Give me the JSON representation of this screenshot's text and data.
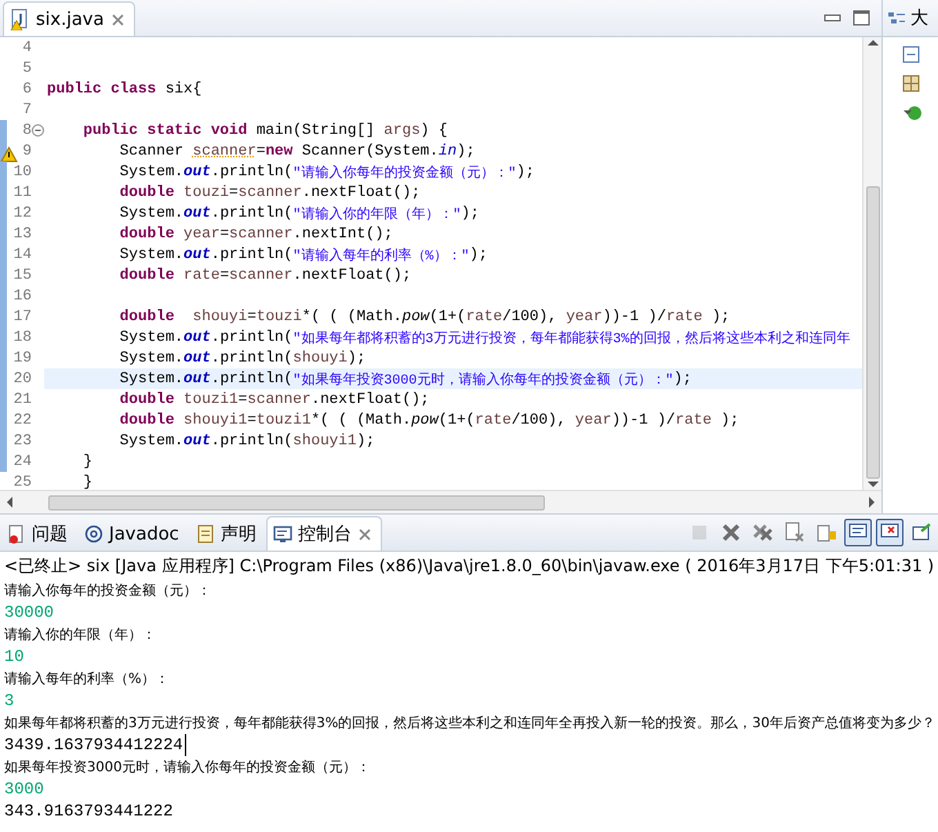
{
  "editor": {
    "tab": {
      "title": "six.java",
      "selected": true,
      "warning": true
    },
    "lines": [
      {
        "number": "4",
        "changed": false,
        "current": false,
        "warning": false,
        "foldable": false
      },
      {
        "number": "5",
        "changed": false,
        "current": false,
        "warning": false,
        "foldable": false
      },
      {
        "number": "6",
        "changed": false,
        "current": false,
        "warning": false,
        "foldable": false,
        "tokens": [
          {
            "kind": "kw",
            "text": "public class"
          },
          {
            "kind": "plain",
            "text": " six{"
          }
        ]
      },
      {
        "number": "7",
        "changed": false,
        "current": false,
        "warning": false,
        "foldable": false
      },
      {
        "number": "8",
        "changed": true,
        "current": false,
        "warning": false,
        "foldable": true,
        "tokens": [
          {
            "kind": "kw",
            "text": "    public static void"
          },
          {
            "kind": "plain",
            "text": " main(String[] "
          },
          {
            "kind": "var",
            "text": "args"
          },
          {
            "kind": "plain",
            "text": ") {"
          }
        ]
      },
      {
        "number": "9",
        "changed": true,
        "current": false,
        "warning": true,
        "foldable": false,
        "tokens": [
          {
            "kind": "plain",
            "text": "        Scanner "
          },
          {
            "kind": "warnvar",
            "text": "scanner"
          },
          {
            "kind": "plain",
            "text": "="
          },
          {
            "kind": "kw",
            "text": "new"
          },
          {
            "kind": "plain",
            "text": " Scanner(System."
          },
          {
            "kind": "static",
            "text": "in"
          },
          {
            "kind": "plain",
            "text": ");"
          }
        ]
      },
      {
        "number": "10",
        "changed": true,
        "current": false,
        "warning": false,
        "foldable": false,
        "tokens": [
          {
            "kind": "plain",
            "text": "        System."
          },
          {
            "kind": "field",
            "text": "out"
          },
          {
            "kind": "plain",
            "text": ".println("
          },
          {
            "kind": "str",
            "text": "\"请输入你每年的投资金额（元）：\""
          },
          {
            "kind": "plain",
            "text": ");"
          }
        ]
      },
      {
        "number": "11",
        "changed": true,
        "current": false,
        "warning": false,
        "foldable": false,
        "tokens": [
          {
            "kind": "kw",
            "text": "        double"
          },
          {
            "kind": "var",
            "text": " touzi"
          },
          {
            "kind": "plain",
            "text": "="
          },
          {
            "kind": "var",
            "text": "scanner"
          },
          {
            "kind": "plain",
            "text": ".nextFloat();"
          }
        ]
      },
      {
        "number": "12",
        "changed": true,
        "current": false,
        "warning": false,
        "foldable": false,
        "tokens": [
          {
            "kind": "plain",
            "text": "        System."
          },
          {
            "kind": "field",
            "text": "out"
          },
          {
            "kind": "plain",
            "text": ".println("
          },
          {
            "kind": "str",
            "text": "\"请输入你的年限（年）：\""
          },
          {
            "kind": "plain",
            "text": ");"
          }
        ]
      },
      {
        "number": "13",
        "changed": true,
        "current": false,
        "warning": false,
        "foldable": false,
        "tokens": [
          {
            "kind": "kw",
            "text": "        double"
          },
          {
            "kind": "var",
            "text": " year"
          },
          {
            "kind": "plain",
            "text": "="
          },
          {
            "kind": "var",
            "text": "scanner"
          },
          {
            "kind": "plain",
            "text": ".nextInt();"
          }
        ]
      },
      {
        "number": "14",
        "changed": true,
        "current": false,
        "warning": false,
        "foldable": false,
        "tokens": [
          {
            "kind": "plain",
            "text": "        System."
          },
          {
            "kind": "field",
            "text": "out"
          },
          {
            "kind": "plain",
            "text": ".println("
          },
          {
            "kind": "str",
            "text": "\"请输入每年的利率（%）：\""
          },
          {
            "kind": "plain",
            "text": ");"
          }
        ]
      },
      {
        "number": "15",
        "changed": true,
        "current": false,
        "warning": false,
        "foldable": false,
        "tokens": [
          {
            "kind": "kw",
            "text": "        double"
          },
          {
            "kind": "var",
            "text": " rate"
          },
          {
            "kind": "plain",
            "text": "="
          },
          {
            "kind": "var",
            "text": "scanner"
          },
          {
            "kind": "plain",
            "text": ".nextFloat();"
          }
        ]
      },
      {
        "number": "16",
        "changed": true,
        "current": false,
        "warning": false,
        "foldable": false
      },
      {
        "number": "17",
        "changed": true,
        "current": false,
        "warning": false,
        "foldable": false,
        "tokens": [
          {
            "kind": "kw",
            "text": "        double"
          },
          {
            "kind": "var",
            "text": "  shouyi"
          },
          {
            "kind": "plain",
            "text": "="
          },
          {
            "kind": "var",
            "text": "touzi"
          },
          {
            "kind": "plain",
            "text": "*( ( (Math."
          },
          {
            "kind": "method",
            "text": "pow"
          },
          {
            "kind": "plain",
            "text": "(1+("
          },
          {
            "kind": "var",
            "text": "rate"
          },
          {
            "kind": "plain",
            "text": "/100), "
          },
          {
            "kind": "var",
            "text": "year"
          },
          {
            "kind": "plain",
            "text": "))-1 )/"
          },
          {
            "kind": "var",
            "text": "rate"
          },
          {
            "kind": "plain",
            "text": " );"
          }
        ]
      },
      {
        "number": "18",
        "changed": true,
        "current": false,
        "warning": false,
        "foldable": false,
        "tokens": [
          {
            "kind": "plain",
            "text": "        System."
          },
          {
            "kind": "field",
            "text": "out"
          },
          {
            "kind": "plain",
            "text": ".println("
          },
          {
            "kind": "str",
            "text": "\"如果每年都将积蓄的3万元进行投资，每年都能获得3%的回报，然后将这些本利之和连同年"
          }
        ]
      },
      {
        "number": "19",
        "changed": true,
        "current": false,
        "warning": false,
        "foldable": false,
        "tokens": [
          {
            "kind": "plain",
            "text": "        System."
          },
          {
            "kind": "field",
            "text": "out"
          },
          {
            "kind": "plain",
            "text": ".println("
          },
          {
            "kind": "var",
            "text": "shouyi"
          },
          {
            "kind": "plain",
            "text": ");"
          }
        ]
      },
      {
        "number": "20",
        "changed": true,
        "current": true,
        "warning": false,
        "foldable": false,
        "tokens": [
          {
            "kind": "plain",
            "text": "        System."
          },
          {
            "kind": "field",
            "text": "out"
          },
          {
            "kind": "plain",
            "text": ".println("
          },
          {
            "kind": "str",
            "text": "\"如果每年投资3000元时，请输入你每年的投资金额（元）：\""
          },
          {
            "kind": "plain",
            "text": ");"
          }
        ]
      },
      {
        "number": "21",
        "changed": true,
        "current": false,
        "warning": false,
        "foldable": false,
        "tokens": [
          {
            "kind": "kw",
            "text": "        double"
          },
          {
            "kind": "var",
            "text": " touzi1"
          },
          {
            "kind": "plain",
            "text": "="
          },
          {
            "kind": "var",
            "text": "scanner"
          },
          {
            "kind": "plain",
            "text": ".nextFloat();"
          }
        ]
      },
      {
        "number": "22",
        "changed": true,
        "current": false,
        "warning": false,
        "foldable": false,
        "tokens": [
          {
            "kind": "kw",
            "text": "        double"
          },
          {
            "kind": "var",
            "text": " shouyi1"
          },
          {
            "kind": "plain",
            "text": "="
          },
          {
            "kind": "var",
            "text": "touzi1"
          },
          {
            "kind": "plain",
            "text": "*( ( (Math."
          },
          {
            "kind": "method",
            "text": "pow"
          },
          {
            "kind": "plain",
            "text": "(1+("
          },
          {
            "kind": "var",
            "text": "rate"
          },
          {
            "kind": "plain",
            "text": "/100), "
          },
          {
            "kind": "var",
            "text": "year"
          },
          {
            "kind": "plain",
            "text": "))-1 )/"
          },
          {
            "kind": "var",
            "text": "rate"
          },
          {
            "kind": "plain",
            "text": " );"
          }
        ]
      },
      {
        "number": "23",
        "changed": true,
        "current": false,
        "warning": false,
        "foldable": false,
        "tokens": [
          {
            "kind": "plain",
            "text": "        System."
          },
          {
            "kind": "field",
            "text": "out"
          },
          {
            "kind": "plain",
            "text": ".println("
          },
          {
            "kind": "var",
            "text": "shouyi1"
          },
          {
            "kind": "plain",
            "text": ");"
          }
        ]
      },
      {
        "number": "24",
        "changed": true,
        "current": false,
        "warning": false,
        "foldable": false,
        "tokens": [
          {
            "kind": "plain",
            "text": "    }"
          }
        ]
      },
      {
        "number": "25",
        "changed": false,
        "current": false,
        "warning": false,
        "foldable": false,
        "tokens": [
          {
            "kind": "plain",
            "text": "    }"
          }
        ]
      }
    ]
  },
  "outline": {
    "tab": {
      "title": "大"
    }
  },
  "console": {
    "tabs": [
      {
        "kind": "problems",
        "label": "问题",
        "selected": false
      },
      {
        "kind": "javadoc",
        "label": "Javadoc",
        "selected": false
      },
      {
        "kind": "declaration",
        "label": "声明",
        "selected": false
      },
      {
        "kind": "console",
        "label": "控制台",
        "selected": true
      }
    ],
    "toolbar": [
      {
        "kind": "stop",
        "disabled": true,
        "pressed": false
      },
      {
        "kind": "remove",
        "disabled": false,
        "pressed": false
      },
      {
        "kind": "remove-all",
        "disabled": false,
        "pressed": false
      },
      {
        "kind": "clear",
        "disabled": false,
        "pressed": false
      },
      {
        "kind": "scroll-lock",
        "disabled": false,
        "pressed": false
      },
      {
        "kind": "show-out",
        "disabled": false,
        "pressed": true
      },
      {
        "kind": "show-err",
        "disabled": false,
        "pressed": true
      },
      {
        "kind": "open",
        "disabled": false,
        "pressed": false
      }
    ],
    "header": "<已终止> six [Java 应用程序] C:\\Program Files (x86)\\Java\\jre1.8.0_60\\bin\\javaw.exe ( 2016年3月17日 下午5:01:31 )",
    "output": [
      {
        "kind": "prompt",
        "text": "请输入你每年的投资金额（元）：",
        "cursor": false
      },
      {
        "kind": "input",
        "text": "30000",
        "cursor": false
      },
      {
        "kind": "prompt",
        "text": "请输入你的年限（年）：",
        "cursor": false
      },
      {
        "kind": "input",
        "text": "10",
        "cursor": false
      },
      {
        "kind": "prompt",
        "text": "请输入每年的利率（%）：",
        "cursor": false
      },
      {
        "kind": "input",
        "text": "3",
        "cursor": false
      },
      {
        "kind": "prompt",
        "text": "如果每年都将积蓄的3万元进行投资，每年都能获得3%的回报，然后将这些本利之和连同年全再投入新一轮的投资。那么，30年后资产总值将变为多少？",
        "cursor": false
      },
      {
        "kind": "result",
        "text": "3439.1637934412224",
        "cursor": true
      },
      {
        "kind": "prompt",
        "text": "如果每年投资3000元时，请输入你每年的投资金额（元）：",
        "cursor": false
      },
      {
        "kind": "input",
        "text": "3000",
        "cursor": false
      },
      {
        "kind": "result",
        "text": "343.9163793441222",
        "cursor": false
      }
    ]
  }
}
